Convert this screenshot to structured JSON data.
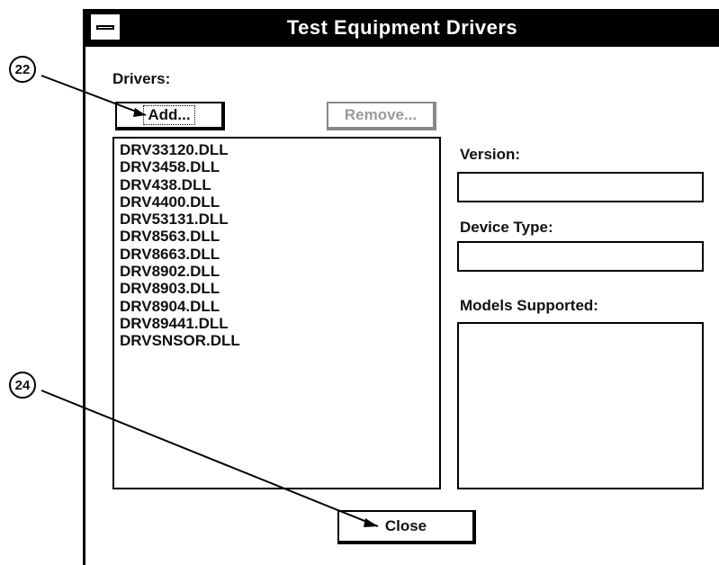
{
  "window": {
    "title": "Test Equipment Drivers"
  },
  "labels": {
    "drivers": "Drivers:",
    "version": "Version:",
    "device_type": "Device Type:",
    "models_supported": "Models Supported:"
  },
  "buttons": {
    "add": "Add...",
    "remove": "Remove...",
    "close": "Close"
  },
  "drivers": [
    "DRV33120.DLL",
    "DRV3458.DLL",
    "DRV438.DLL",
    "DRV4400.DLL",
    "DRV53131.DLL",
    "DRV8563.DLL",
    "DRV8663.DLL",
    "DRV8902.DLL",
    "DRV8903.DLL",
    "DRV8904.DLL",
    "DRV89441.DLL",
    "DRVSNSOR.DLL"
  ],
  "fields": {
    "version": "",
    "device_type": "",
    "models_supported": ""
  },
  "callouts": {
    "add_ref": "22",
    "close_ref": "24"
  }
}
